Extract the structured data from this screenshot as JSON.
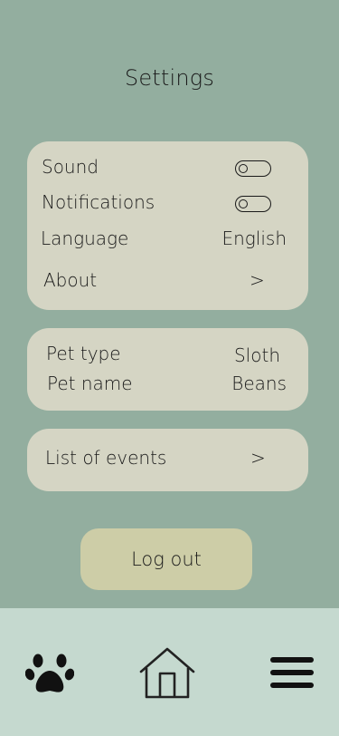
{
  "header": {
    "title": "Settings"
  },
  "general": {
    "sound_label": "Sound",
    "notifications_label": "Notifications",
    "language_label": "Language",
    "language_value": "English",
    "about_label": "About",
    "chevron": ">"
  },
  "pet": {
    "type_label": "Pet type",
    "type_value": "Sloth",
    "name_label": "Pet name",
    "name_value": "Beans"
  },
  "events": {
    "label": "List of events",
    "chevron": ">"
  },
  "logout_label": "Log out",
  "navbar": {
    "items": [
      {
        "icon": "paw-icon"
      },
      {
        "icon": "home-icon"
      },
      {
        "icon": "menu-icon"
      }
    ]
  },
  "colors": {
    "background": "#93ae9f",
    "card": "#d5d5c4",
    "logout_button": "#cdcda7",
    "navbar": "#c5d9cf"
  }
}
